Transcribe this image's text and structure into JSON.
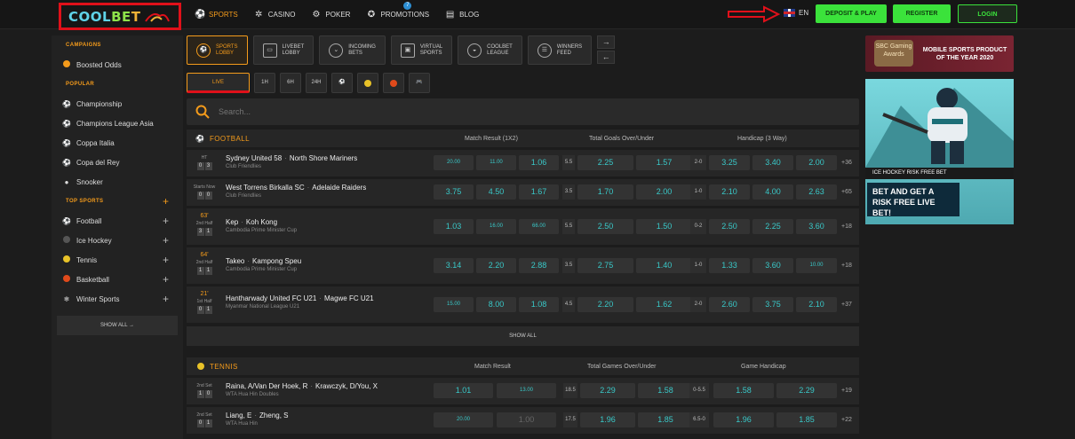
{
  "brand": {
    "l1": "COOL",
    "l2": "BE",
    "l3": "T"
  },
  "nav": [
    {
      "label": "SPORTS",
      "icon": "ball-icon",
      "active": true
    },
    {
      "label": "CASINO",
      "icon": "casino-icon"
    },
    {
      "label": "POKER",
      "icon": "poker-icon"
    },
    {
      "label": "PROMOTIONS",
      "icon": "promotions-icon",
      "badge": "7"
    },
    {
      "label": "BLOG",
      "icon": "blog-icon"
    }
  ],
  "lang": "EN",
  "buttons": {
    "deposit": "DEPOSIT & PLAY",
    "register": "REGISTER",
    "login": "LOGIN"
  },
  "sidebar": {
    "campaigns_title": "CAMPAIGNS",
    "boosted": "Boosted Odds",
    "popular_title": "POPULAR",
    "popular": [
      "Championship",
      "Champions League Asia",
      "Coppa Italia",
      "Copa del Rey",
      "Snooker"
    ],
    "top_title": "TOP SPORTS",
    "top": [
      "Football",
      "Ice Hockey",
      "Tennis",
      "Basketball",
      "Winter Sports"
    ],
    "show_all": "SHOW ALL →"
  },
  "lobby": [
    {
      "l1": "SPORTS",
      "l2": "LOBBY",
      "active": true
    },
    {
      "l1": "LIVEBET",
      "l2": "LOBBY"
    },
    {
      "l1": "INCOMING",
      "l2": "BETS"
    },
    {
      "l1": "VIRTUAL",
      "l2": "SPORTS"
    },
    {
      "l1": "COOLBET",
      "l2": "LEAGUE"
    },
    {
      "l1": "WINNERS",
      "l2": "FEED"
    }
  ],
  "filters": {
    "live": "LIVE",
    "h1": "1H",
    "h6": "6H",
    "h24": "24H"
  },
  "search_placeholder": "Search...",
  "football": {
    "title": "FOOTBALL",
    "cols": [
      "Match Result (1X2)",
      "Total Goals Over/Under",
      "Handicap (3 Way)"
    ],
    "rows": [
      {
        "status": "HT",
        "time": "",
        "s1": "0",
        "s2": "3",
        "home": "Sydney United 58",
        "away": "North Shore Mariners",
        "league": "Club Friendlies",
        "o1": "20.00",
        "ox": "11.00",
        "o2": "1.06",
        "tl": "5.5",
        "ov": "2.25",
        "un": "1.57",
        "hl": "2-0",
        "h1": "3.25",
        "hx": "3.40",
        "h2": "2.00",
        "more": "+36"
      },
      {
        "status": "Starts Now",
        "time": "",
        "s1": "0",
        "s2": "0",
        "home": "West Torrens Birkalla SC",
        "away": "Adelaide Raiders",
        "league": "Club Friendlies",
        "o1": "3.75",
        "ox": "4.50",
        "o2": "1.67",
        "tl": "3.5",
        "ov": "1.70",
        "un": "2.00",
        "hl": "1-0",
        "h1": "2.10",
        "hx": "4.00",
        "h2": "2.63",
        "more": "+65"
      },
      {
        "status": "2nd Half",
        "time": "63'",
        "s1": "3",
        "s2": "1",
        "home": "Kep",
        "away": "Koh Kong",
        "league": "Cambodia Prime Minister Cup",
        "o1": "1.03",
        "ox": "16.00",
        "o2": "66.00",
        "tl": "5.5",
        "ov": "2.50",
        "un": "1.50",
        "hl": "0-2",
        "h1": "2.50",
        "hx": "2.25",
        "h2": "3.60",
        "more": "+18"
      },
      {
        "status": "2nd Half",
        "time": "64'",
        "s1": "1",
        "s2": "1",
        "home": "Takeo",
        "away": "Kampong Speu",
        "league": "Cambodia Prime Minister Cup",
        "o1": "3.14",
        "ox": "2.20",
        "o2": "2.88",
        "tl": "3.5",
        "ov": "2.75",
        "un": "1.40",
        "hl": "1-0",
        "h1": "1.33",
        "hx": "3.60",
        "h2": "10.00",
        "more": "+18"
      },
      {
        "status": "1st Half",
        "time": "21'",
        "s1": "0",
        "s2": "1",
        "home": "Hantharwady United FC U21",
        "away": "Magwe FC U21",
        "league": "Myanmar National League U21",
        "o1": "15.00",
        "ox": "8.00",
        "o2": "1.08",
        "tl": "4.5",
        "ov": "2.20",
        "un": "1.62",
        "hl": "2-0",
        "h1": "2.60",
        "hx": "3.75",
        "h2": "2.10",
        "more": "+37"
      }
    ],
    "show_all": "SHOW ALL"
  },
  "tennis": {
    "title": "TENNIS",
    "cols": [
      "Match Result",
      "Total Games Over/Under",
      "Game Handicap"
    ],
    "rows": [
      {
        "status": "2nd Set",
        "s1": "1",
        "s2": "0",
        "home": "Raina, A/Van Der Hoek, R",
        "away": "Krawczyk, D/You, X",
        "league": "WTA Hua Hin Doubles",
        "o1": "1.01",
        "o2": "13.00",
        "tl": "18.5",
        "ov": "2.29",
        "un": "1.58",
        "hl": "0-5.5",
        "h1": "1.58",
        "h2": "2.29",
        "more": "+19"
      },
      {
        "status": "2nd Set",
        "s1": "0",
        "s2": "1",
        "home": "Liang, E",
        "away": "Zheng, S",
        "league": "WTA Hua Hin",
        "o1": "20.00",
        "o2": "1.00",
        "tl": "17.5",
        "ov": "1.96",
        "un": "1.85",
        "hl": "6.5-0",
        "h1": "1.96",
        "h2": "1.85",
        "more": "+22"
      }
    ]
  },
  "promo1": {
    "seal": "SBC Gaming Awards",
    "text": "MOBILE SPORTS PRODUCT OF THE YEAR 2020"
  },
  "promo2": {
    "cap": "ICE HOCKEY RISK FREE BET",
    "big": "BET AND GET A RISK FREE LIVE BET!"
  }
}
